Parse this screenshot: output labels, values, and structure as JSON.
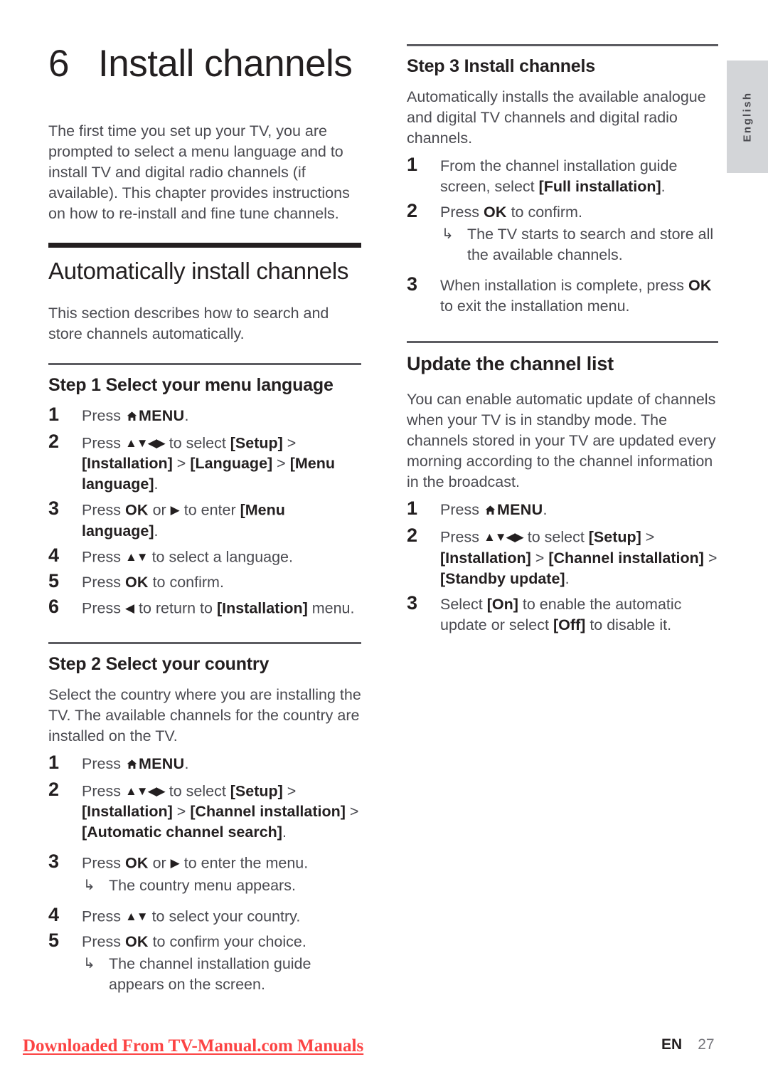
{
  "side_tab": {
    "label": "English"
  },
  "chapter": {
    "number": "6",
    "title": "Install channels",
    "intro": "The first time you set up your TV, you are prompted to select a menu language and to install TV and digital radio channels (if available). This chapter provides instructions on how to re-install and fine tune channels."
  },
  "section_auto_install": {
    "heading": "Automatically install channels",
    "intro": "This section describes how to search and store channels automatically."
  },
  "step1": {
    "heading": "Step 1 Select your menu language",
    "items": [
      {
        "text_before": "Press ",
        "icon": "home-icon",
        "key": "MENU",
        "text_after": "."
      },
      {
        "text": "Press ▲▼◀▶ to select [Setup] > [Installation] > [Language] > [Menu language]."
      },
      {
        "text": "Press OK or ▶ to enter [Menu language]."
      },
      {
        "text": "Press ▲▼ to select a language."
      },
      {
        "text": "Press OK to confirm."
      },
      {
        "text": "Press ◀ to return to [Installation] menu."
      }
    ]
  },
  "step2": {
    "heading": "Step 2 Select your country",
    "intro": "Select the country where you are installing the TV. The available channels for the country are installed on the TV.",
    "items": [
      {
        "text": "Press ⌂ MENU."
      },
      {
        "text": "Press ▲▼◀▶ to select [Setup] > [Installation] > [Channel installation] > [Automatic channel search]."
      },
      {
        "text": "Press OK or ▶ to enter the menu.",
        "result": "The country menu appears."
      },
      {
        "text": "Press ▲▼ to select your country."
      },
      {
        "text": "Press OK to confirm your choice.",
        "result": "The channel installation guide appears on the screen."
      }
    ]
  },
  "step3": {
    "heading": "Step 3 Install channels",
    "intro": "Automatically installs the available analogue and digital TV channels and digital radio channels.",
    "items": [
      {
        "text": "From the channel installation guide screen, select [Full installation]."
      },
      {
        "text": "Press OK to confirm.",
        "result": "The TV starts to search and store all the available channels."
      },
      {
        "text": "When installation is complete, press OK to exit the installation menu."
      }
    ]
  },
  "section_update": {
    "heading": "Update the channel list",
    "intro": "You can enable automatic update of channels when your TV is in standby mode. The channels stored in your TV are updated every morning according to the channel information in the broadcast.",
    "items": [
      {
        "text": "Press ⌂ MENU."
      },
      {
        "text": "Press ▲▼◀▶ to select [Setup] > [Installation] > [Channel installation] > [Standby update]."
      },
      {
        "text": "Select [On] to enable the automatic update or select [Off] to disable it."
      }
    ]
  },
  "footer": {
    "watermark": "Downloaded From TV-Manual.com Manuals",
    "lang_code": "EN",
    "page_number": "27"
  },
  "fragments": {
    "press": "Press ",
    "menu_word": "MENU",
    "period": ".",
    "to_select": " to select ",
    "setup": "[Setup]",
    "gt": " > ",
    "installation": "[Installation]",
    "language": "[Language]",
    "menu_language": "[Menu language]",
    "channel_installation": "[Channel installation]",
    "automatic_channel_search": "[Automatic channel search]",
    "standby_update": "[Standby update]",
    "full_installation": "[Full installation]",
    "on": "[On]",
    "off": "[Off]",
    "ok": "OK",
    "or": " or ",
    "to_enter": " to enter ",
    "to_enter_the_menu": " to enter the menu.",
    "to_select_a_language": " to select a language.",
    "to_select_your_country": " to select your country.",
    "to_confirm": " to confirm.",
    "to_confirm_your_choice": " to confirm your choice.",
    "to_return_to": " to return to ",
    "menu_lower": " menu.",
    "s1_result_country": "The country menu appears.",
    "s2_result_guide": "The channel installation guide appears on the screen.",
    "s3_1_a": "From the channel installation guide screen, select ",
    "s3_2_result": "The TV starts to search and store all the available channels.",
    "s3_3_a": "When installation is complete, press ",
    "s3_3_b": " to exit the installation menu.",
    "up_down": "▲▼",
    "up_down_left_right": "▲▼◀▶",
    "right_tri": "▶",
    "left_tri": "◀",
    "hook": "↳",
    "upd_3_a": "Select ",
    "upd_3_b": " to enable the automatic update or select ",
    "upd_3_c": " to disable it."
  }
}
